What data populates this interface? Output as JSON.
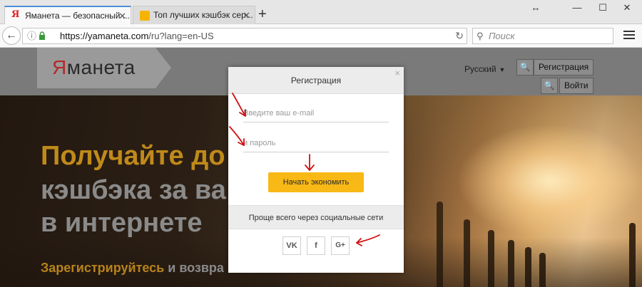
{
  "browser": {
    "tabs": [
      {
        "favicon": "Я",
        "title": "Яманета — безопасный ...",
        "active": true
      },
      {
        "favicon": "",
        "title": "Топ лучших кэшбэк сер...",
        "active": false
      }
    ],
    "new_tab": "+",
    "window_controls": {
      "resize": "↔",
      "minimize": "—",
      "maximize": "☐",
      "close": "✕"
    },
    "url": {
      "info": "ⓘ",
      "host": "https://yamaneta.com",
      "path": "/ru?lang=en-US",
      "reload": "↻"
    },
    "search": {
      "icon": "⚲",
      "placeholder": "Поиск"
    },
    "back": "←"
  },
  "site": {
    "logo": {
      "first": "Я",
      "rest": "манета"
    },
    "language": "Русский",
    "language_caret": "▼",
    "register_button": "Регистрация",
    "login_button": "Войти",
    "key_icon": "🔍"
  },
  "hero": {
    "line1": "Получайте до",
    "line2": "кэшбэка за ва",
    "line3": "в интернете",
    "sub_highlight": "Зарегистрируйтесь",
    "sub_rest": " и возвра"
  },
  "modal": {
    "title": "Регистрация",
    "close": "×",
    "email_placeholder": "Введите ваш e-mail",
    "password_placeholder": "и пароль",
    "submit": "Начать экономить",
    "social_heading": "Проще всего через социальные сети",
    "social": {
      "vk": "VK",
      "facebook": "f",
      "google": "G+"
    }
  },
  "colors": {
    "accent": "#f8b816",
    "annotation": "#d01010",
    "tab_highlight": "#4a90d9"
  }
}
